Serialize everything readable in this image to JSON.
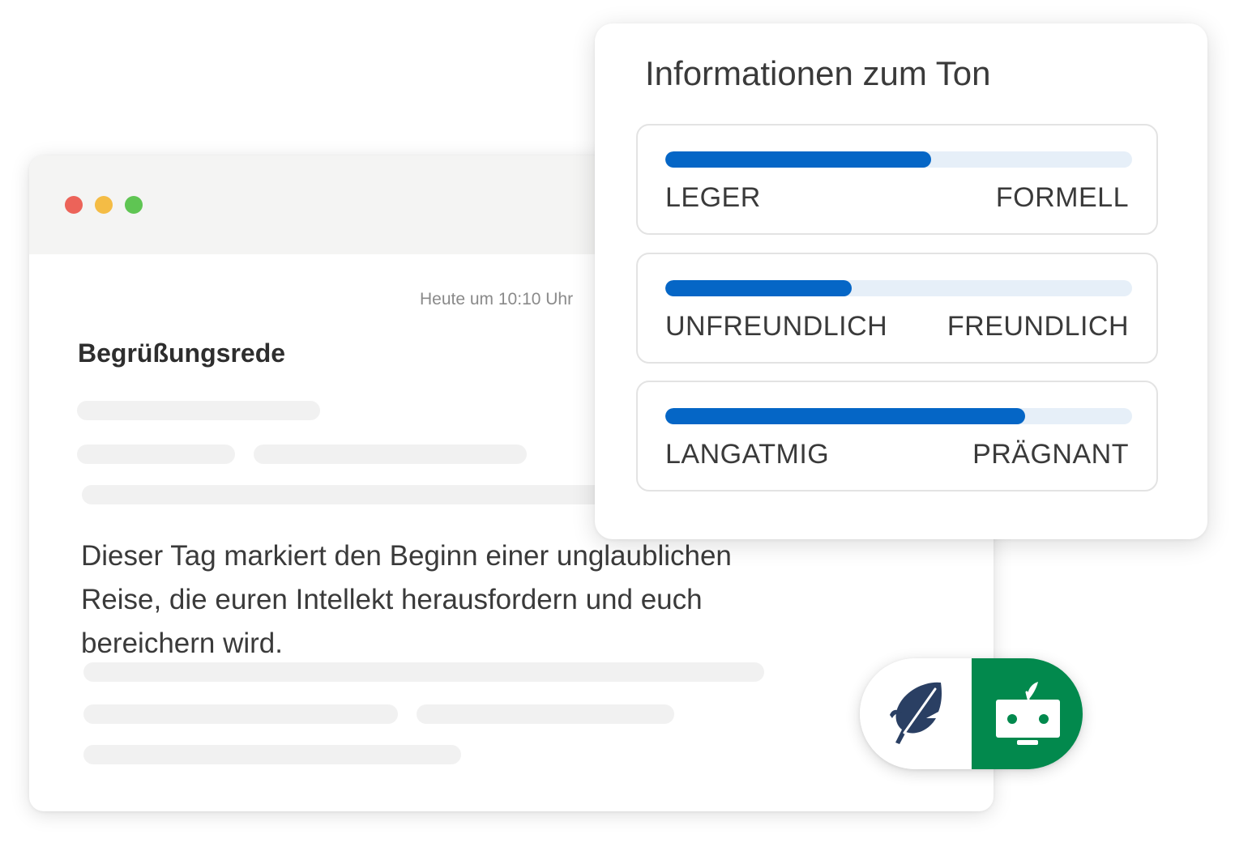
{
  "editor": {
    "timestamp": "Heute um 10:10 Uhr",
    "title": "Begrüßungsrede",
    "body": "Dieser Tag markiert den Beginn einer unglaublichen Reise, die euren Intellekt herausfordern und euch bereichern wird."
  },
  "tone": {
    "heading": "Informationen zum Ton",
    "scales": [
      {
        "left_label": "LEGER",
        "right_label": "FORMELL",
        "level_pct": 57
      },
      {
        "left_label": "UNFREUNDLICH",
        "right_label": "FREUNDLICH",
        "level_pct": 40
      },
      {
        "left_label": "LANGATMIG",
        "right_label": "PRÄGNANT",
        "level_pct": 77
      }
    ]
  },
  "widget": {
    "left_icon": "feather-icon",
    "right_icon": "robot-icon"
  },
  "colors": {
    "accent_blue": "#0566c6",
    "track_blue": "#e6eff8",
    "brand_green": "#02894d",
    "feather_navy": "#2a3f63",
    "window_dot_red": "#ec6359",
    "window_dot_yellow": "#f4bc45",
    "window_dot_green": "#5fc553"
  }
}
